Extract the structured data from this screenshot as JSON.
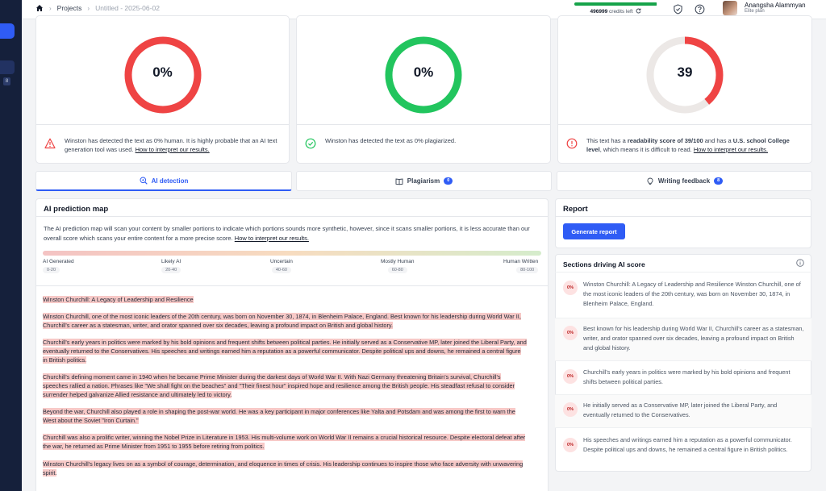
{
  "header": {
    "breadcrumb": {
      "projects": "Projects",
      "file": "Untitled - 2025-06-02"
    },
    "credits": {
      "amount": "496999",
      "label": " credits left",
      "progress": 0.99
    },
    "user": {
      "name": "Anangsha Alammyan",
      "plan": "Elite plan"
    }
  },
  "sidebar": {
    "badge": "8"
  },
  "scores": {
    "human": {
      "value": "0%",
      "percent": 0,
      "color": "#ef4444",
      "message": "Winston has detected the text as 0% human. It is highly probable that an AI text generation tool was used.",
      "link": "How to interpret our results."
    },
    "plagiarism": {
      "value": "0%",
      "percent": 0,
      "color": "#22c55e",
      "message": "Winston has detected the text as 0% plagiarized."
    },
    "readability": {
      "value": "39",
      "percent": 39,
      "color": "#ef4444",
      "message_pre": "This text has a ",
      "message_bold1": "readability score of 39/100",
      "message_mid": " and has a ",
      "message_bold2": "U.S. school College level",
      "message_post": ", which means it is difficult to read. ",
      "link": "How to interpret our results."
    }
  },
  "tabs": [
    {
      "label": "AI detection",
      "badge": ""
    },
    {
      "label": "Plagiarism",
      "badge": "0"
    },
    {
      "label": "Writing feedback",
      "badge": "8"
    }
  ],
  "prediction": {
    "title": "AI prediction map",
    "description": "The AI prediction map will scan your content by smaller portions to indicate which portions sounds more synthetic, however, since it scans smaller portions, it is less accurate than our overall score which scans your entire content for a more precise score. ",
    "link": "How to interpret our results.",
    "scale": [
      {
        "label": "AI Generated",
        "range": "0-20"
      },
      {
        "label": "Likely AI",
        "range": "20-40"
      },
      {
        "label": "Uncertain",
        "range": "40-60"
      },
      {
        "label": "Mostly Human",
        "range": "60-80"
      },
      {
        "label": "Human Written",
        "range": "80-100"
      }
    ],
    "paragraphs": [
      "Winston Churchill: A Legacy of Leadership and Resilience",
      "Winston Churchill, one of the most iconic leaders of the 20th century, was born on November 30, 1874, in Blenheim Palace, England. Best known for his leadership during World War II, Churchill's career as a statesman, writer, and orator spanned over six decades, leaving a profound impact on British and global history.",
      "Churchill's early years in politics were marked by his bold opinions and frequent shifts between political parties. He initially served as a Conservative MP, later joined the Liberal Party, and eventually returned to the Conservatives. His speeches and writings earned him a reputation as a powerful communicator. Despite political ups and downs, he remained a central figure in British politics.",
      "Churchill's defining moment came in 1940 when he became Prime Minister during the darkest days of World War II. With Nazi Germany threatening Britain's survival, Churchill's speeches rallied a nation. Phrases like \"We shall fight on the beaches\" and \"Their finest hour\" inspired hope and resilience among the British people. His steadfast refusal to consider surrender helped galvanize Allied resistance and ultimately led to victory.",
      "Beyond the war, Churchill also played a role in shaping the post-war world. He was a key participant in major conferences like Yalta and Potsdam and was among the first to warn the West about the Soviet \"Iron Curtain.\"",
      "Churchill was also a prolific writer, winning the Nobel Prize in Literature in 1953. His multi-volume work on World War II remains a crucial historical resource. Despite electoral defeat after the war, he returned as Prime Minister from 1951 to 1955 before retiring from politics.",
      "Winston Churchill's legacy lives on as a symbol of courage, determination, and eloquence in times of crisis. His leadership continues to inspire those who face adversity with unwavering spirit."
    ]
  },
  "report": {
    "title": "Report",
    "button": "Generate report",
    "sections_title": "Sections driving AI score",
    "sections": [
      {
        "score": "0%",
        "text": "Winston Churchill: A Legacy of Leadership and Resilience Winston Churchill, one of the most iconic leaders of the 20th century, was born on November 30, 1874, in Blenheim Palace, England."
      },
      {
        "score": "0%",
        "text": "Best known for his leadership during World War II, Churchill's career as a statesman, writer, and orator spanned over six decades, leaving a profound impact on British and global history."
      },
      {
        "score": "0%",
        "text": "Churchill's early years in politics were marked by his bold opinions and frequent shifts between political parties."
      },
      {
        "score": "0%",
        "text": "He initially served as a Conservative MP, later joined the Liberal Party, and eventually returned to the Conservatives."
      },
      {
        "score": "0%",
        "text": "His speeches and writings earned him a reputation as a powerful communicator. Despite political ups and downs, he remained a central figure in British politics."
      }
    ]
  }
}
